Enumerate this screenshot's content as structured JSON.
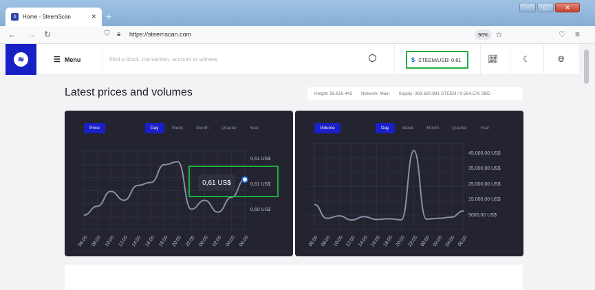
{
  "browser": {
    "tab_title": "Home - SteemScan",
    "tab_close": "✕",
    "new_tab": "+",
    "url": "https://steemscan.com",
    "zoom": "90%",
    "window_controls": [
      "–",
      "□",
      "✕"
    ]
  },
  "header": {
    "menu_label": "Menu",
    "search_placeholder": "Find a block, transaction, account or witness",
    "price_label": "STEEM/USD: 0,61",
    "price_symbol": "$"
  },
  "page": {
    "title": "Latest prices and volumes",
    "stats": {
      "height": "Height: 58.816.442",
      "network": "Network: Main",
      "supply": "Supply: 393.680.881 STEEM / 9.564.576 SBD"
    }
  },
  "price_card": {
    "badge": "Price",
    "range_tabs": [
      "Day",
      "Week",
      "Month",
      "Quarter",
      "Year"
    ],
    "active_range": "Day",
    "tooltip": "0,61 US$"
  },
  "volume_card": {
    "badge": "Volume",
    "range_tabs": [
      "Day",
      "Week",
      "Month",
      "Quarter",
      "Year"
    ],
    "active_range": "Day"
  },
  "chart_data": [
    {
      "type": "line",
      "title": "Price",
      "x": [
        "06:00",
        "08:00",
        "10:00",
        "12:00",
        "14:00",
        "16:00",
        "18:00",
        "20:00",
        "22:00",
        "00:00",
        "02:00",
        "04:00",
        "06:00"
      ],
      "y_ticks": [
        "0,61 US$",
        "0,61 US$",
        "0,60 US$"
      ],
      "series": [
        {
          "name": "Price",
          "values": [
            0.598,
            0.601,
            0.606,
            0.603,
            0.608,
            0.609,
            0.615,
            0.616,
            0.6,
            0.603,
            0.599,
            0.604,
            0.61
          ]
        }
      ],
      "line_color": "#8d8ea8",
      "highlight_value": "0,61 US$"
    },
    {
      "type": "line",
      "title": "Volume",
      "x": [
        "06:00",
        "08:00",
        "10:00",
        "12:00",
        "14:00",
        "16:00",
        "18:00",
        "20:00",
        "22:00",
        "00:00",
        "02:00",
        "04:00",
        "06:00"
      ],
      "y_ticks": [
        "45.000,00 US$",
        "35.000,00 US$",
        "25.000,00 US$",
        "15.000,00 US$",
        "5000,00 US$"
      ],
      "series": [
        {
          "name": "Volume",
          "values": [
            12000,
            3500,
            5000,
            2500,
            4500,
            2800,
            3200,
            2600,
            45000,
            3000,
            3500,
            4200,
            8000
          ]
        }
      ],
      "line_color": "#8d8ea8"
    }
  ]
}
